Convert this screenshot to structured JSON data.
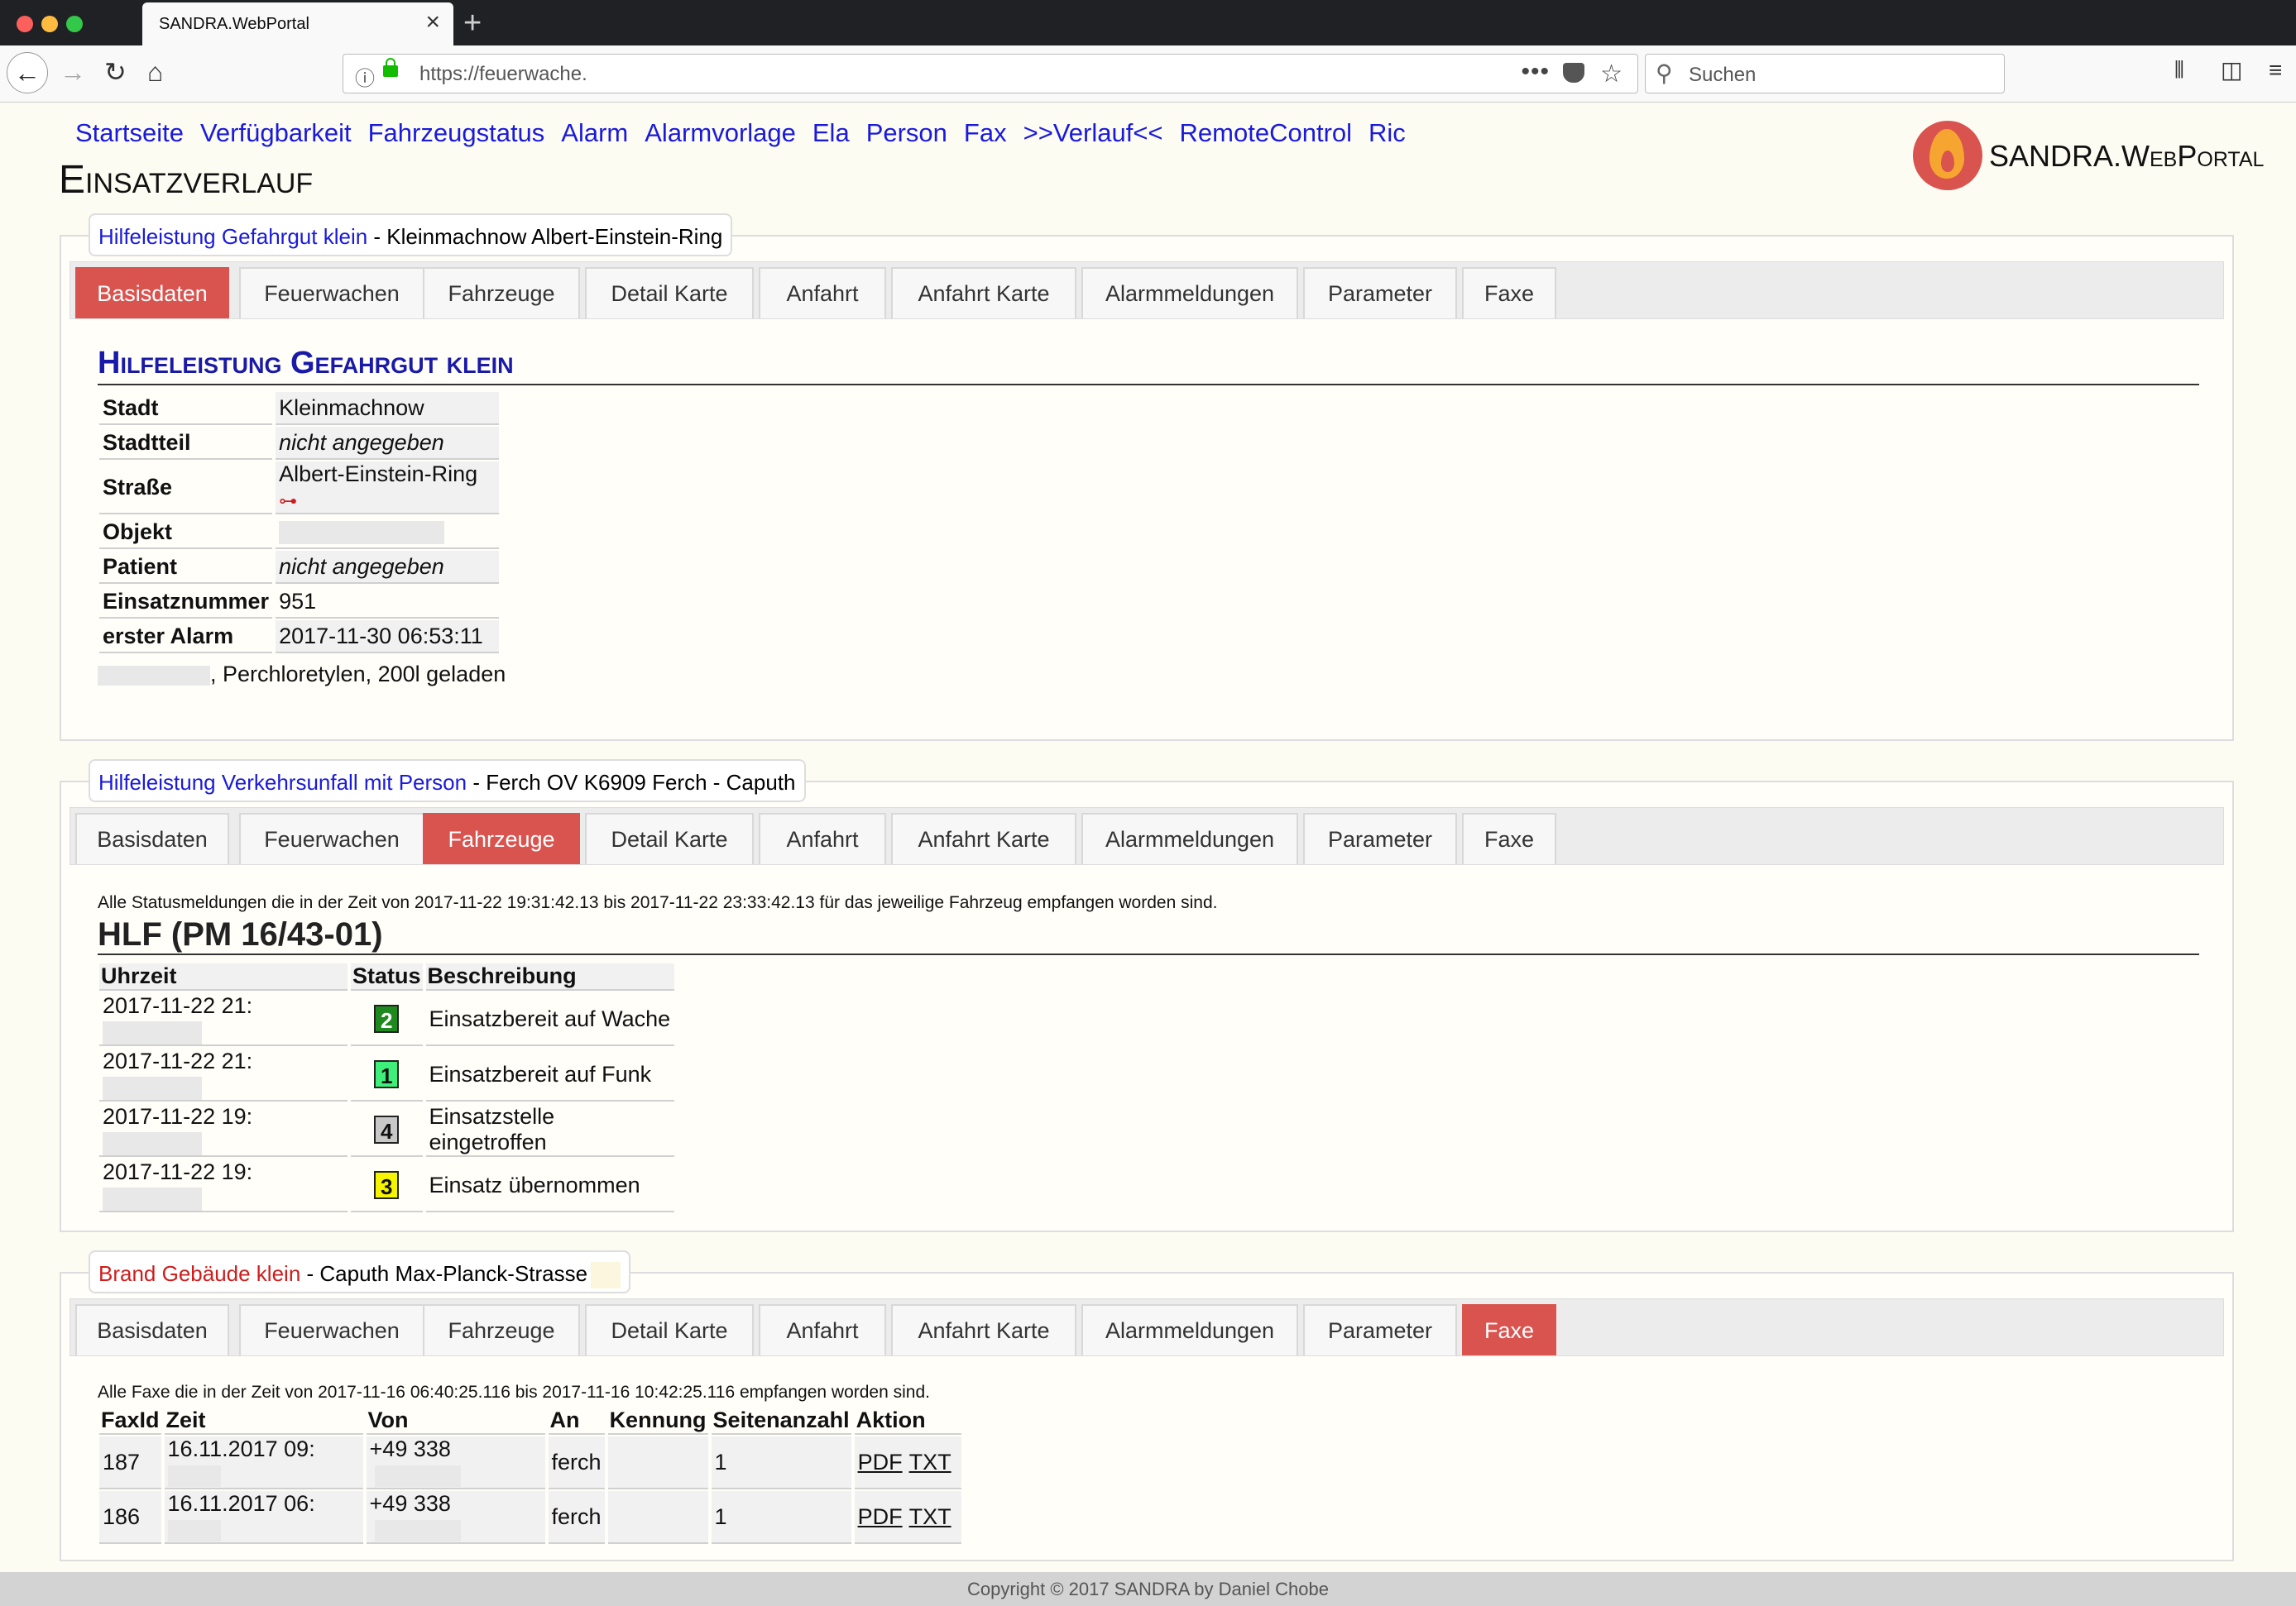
{
  "browser": {
    "tab_title": "SANDRA.WebPortal",
    "url": "https://feuerwache.",
    "search_placeholder": "Suchen"
  },
  "nav": [
    "Startseite",
    "Verfügbarkeit",
    "Fahrzeugstatus",
    "Alarm",
    "Alarmvorlage",
    "Ela",
    "Person",
    "Fax",
    ">>Verlauf<<",
    "RemoteControl",
    "Ric"
  ],
  "logo_text": "SANDRA.WebPortal",
  "page_title": "Einsatzverlauf",
  "tabs": [
    "Basisdaten",
    "Feuerwachen",
    "Fahrzeuge",
    "Detail Karte",
    "Anfahrt",
    "Anfahrt Karte",
    "Alarmmeldungen",
    "Parameter",
    "Faxe"
  ],
  "incidents": [
    {
      "type": "Hilfeleistung Gefahrgut klein",
      "location": " - Kleinmachnow Albert-Einstein-Ring",
      "active_tab": "Basisdaten",
      "heading": "Hilfeleistung Gefahrgut klein",
      "fields": [
        {
          "label": "Stadt",
          "value": "Kleinmachnow"
        },
        {
          "label": "Stadtteil",
          "value": "nicht angegeben"
        },
        {
          "label": "Straße",
          "value": "Albert-Einstein-Ring"
        },
        {
          "label": "Objekt",
          "value": ""
        },
        {
          "label": "Patient",
          "value": "nicht angegeben"
        },
        {
          "label": "Einsatznummer",
          "value": "951"
        },
        {
          "label": "erster Alarm",
          "value": "2017-11-30 06:53:11"
        }
      ],
      "remark": ", Perchloretylen, 200l geladen"
    },
    {
      "type": "Hilfeleistung Verkehrsunfall mit Person",
      "location": " - Ferch OV K6909 Ferch - Caputh",
      "active_tab": "Fahrzeuge",
      "note": "Alle Statusmeldungen die in der Zeit von 2017-11-22 19:31:42.13 bis 2017-11-22 23:33:42.13 für das jeweilige Fahrzeug empfangen worden sind.",
      "vehicle": "HLF (PM 16/43-01)",
      "columns": [
        "Uhrzeit",
        "Status",
        "Beschreibung"
      ],
      "rows": [
        {
          "time": "2017-11-22 21:",
          "status": "2",
          "color": "#1e8a1e",
          "text_color": "#ffffff",
          "desc": "Einsatzbereit auf Wache"
        },
        {
          "time": "2017-11-22 21:",
          "status": "1",
          "color": "#3ef07a",
          "text_color": "#111111",
          "desc": "Einsatzbereit auf Funk"
        },
        {
          "time": "2017-11-22 19:",
          "status": "4",
          "color": "#c8c8c8",
          "text_color": "#111111",
          "desc": "Einsatzstelle eingetroffen"
        },
        {
          "time": "2017-11-22 19:",
          "status": "3",
          "color": "#f5f500",
          "text_color": "#111111",
          "desc": "Einsatz übernommen"
        }
      ]
    },
    {
      "type": "Brand Gebäude klein",
      "location": " - Caputh Max-Planck-Strasse",
      "active_tab": "Faxe",
      "note": "Alle Faxe die in der Zeit von 2017-11-16 06:40:25.116 bis 2017-11-16 10:42:25.116 empfangen worden sind.",
      "columns": [
        "FaxId",
        "Zeit",
        "Von",
        "An",
        "Kennung",
        "Seitenanzahl",
        "Aktion"
      ],
      "rows": [
        {
          "id": "187",
          "time": "16.11.2017 09:",
          "from": "+49 338",
          "to": "ferch",
          "kennung": "",
          "pages": "1",
          "pdf": "PDF",
          "txt": "TXT"
        },
        {
          "id": "186",
          "time": "16.11.2017 06:",
          "from": "+49 338",
          "to": "ferch",
          "kennung": "",
          "pages": "1",
          "pdf": "PDF",
          "txt": "TXT"
        }
      ]
    }
  ],
  "footer": "Copyright © 2017 SANDRA by Daniel Chobe",
  "colors": {
    "accent": "#d9534f",
    "link": "#1a1adb",
    "heading": "#1a1aa8",
    "incident_red": "#d01c1c"
  }
}
